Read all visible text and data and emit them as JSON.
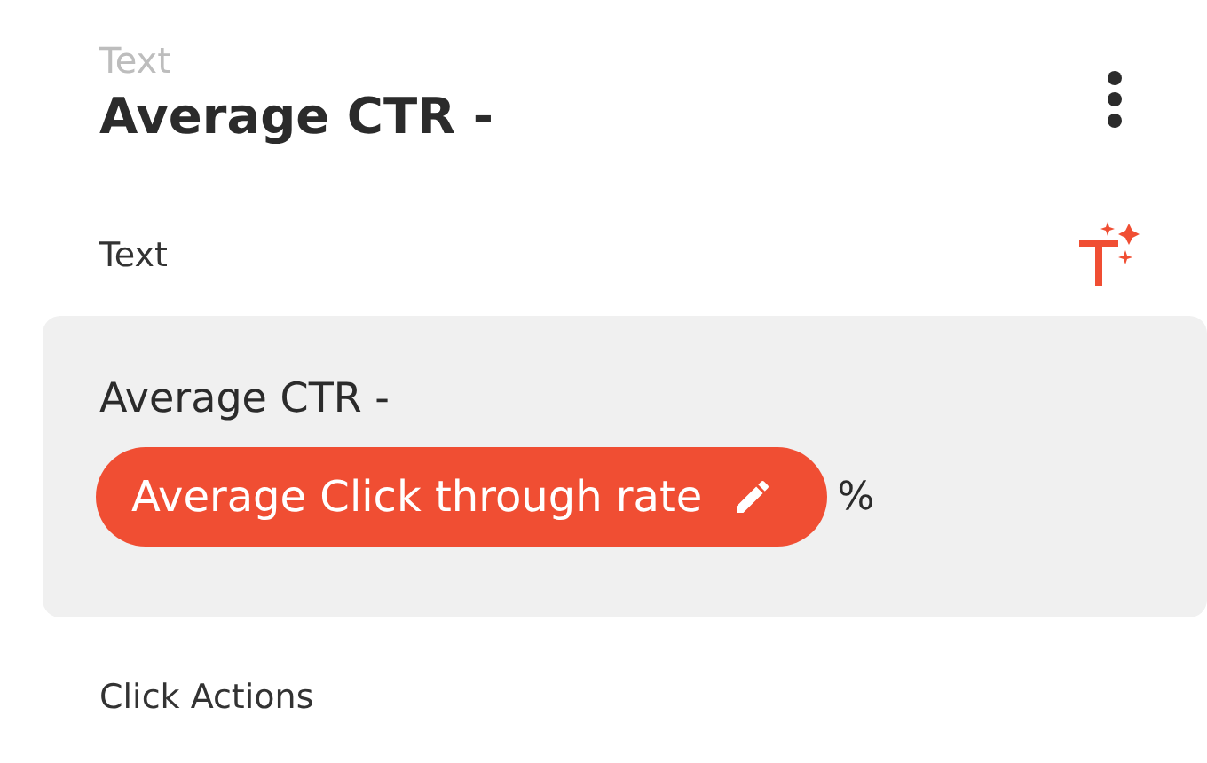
{
  "header": {
    "kind_label": "Text",
    "title": "Average CTR -"
  },
  "section_label": "Text",
  "editor": {
    "text": "Average CTR -",
    "chips": [
      {
        "label": "Average Click through rate"
      }
    ],
    "suffix": "%"
  },
  "next_section_label": "Click Actions"
}
